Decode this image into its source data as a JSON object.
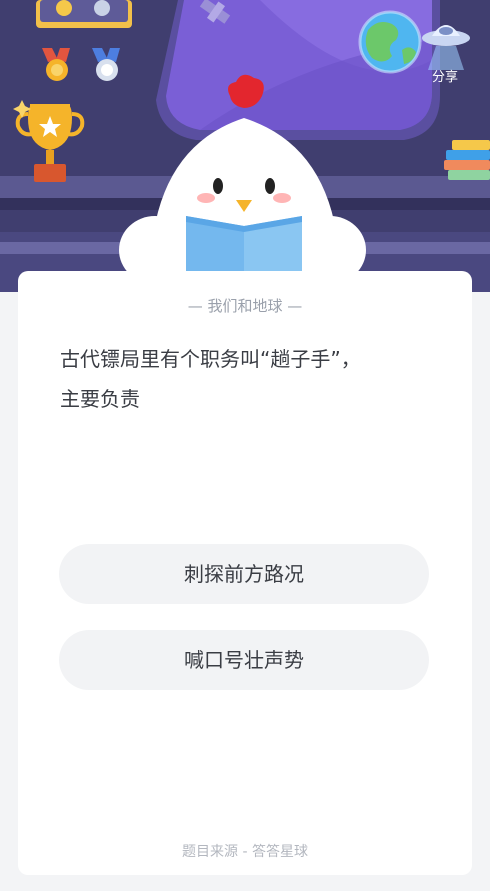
{
  "header": {
    "share_label": "分享"
  },
  "quiz": {
    "category": "— 我们和地球 —",
    "question_lines": [
      "古代镖局里有个职务叫“趟子手”，",
      "主要负责"
    ],
    "options": [
      "刺探前方路况",
      "喊口号壮声势"
    ],
    "source": "题目来源 - 答答星球"
  },
  "icons": [
    "medal-icon",
    "trophy-icon",
    "earth-icon",
    "satellite-icon",
    "ufo-icon",
    "books-icon",
    "chick-mascot"
  ],
  "colors": {
    "scene_bg": "#3f3d6e",
    "window_frame": "#5a4fa0",
    "window_glass": "#7a5fd6",
    "card_bg": "#ffffff",
    "option_bg": "#f2f3f5",
    "text_main": "#3a3d44",
    "text_muted": "#9aa0ab"
  }
}
